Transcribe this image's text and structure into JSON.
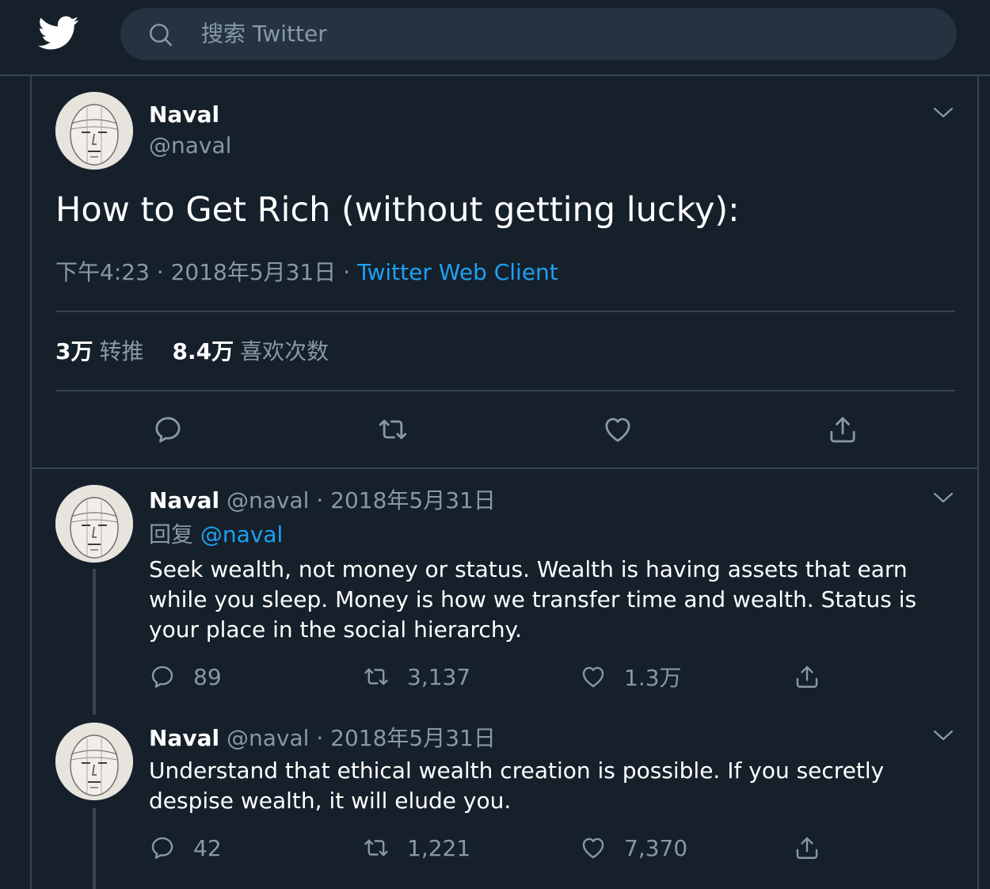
{
  "search": {
    "placeholder": "搜索 Twitter"
  },
  "main_tweet": {
    "name": "Naval",
    "handle": "@naval",
    "text": "How to Get Rich (without getting lucky):",
    "time": "下午4:23",
    "dot": "·",
    "date": "2018年5月31日",
    "source": "Twitter Web Client",
    "retweets_count": "3万",
    "retweets_label": "转推",
    "likes_count": "8.4万",
    "likes_label": "喜欢次数"
  },
  "replies": [
    {
      "name": "Naval",
      "handle": "@naval",
      "dot": "·",
      "date": "2018年5月31日",
      "reply_prefix": "回复",
      "reply_to": "@naval",
      "text": "Seek wealth, not money or status. Wealth is having assets that earn while you sleep. Money is how we transfer time and wealth. Status is your place in the social hierarchy.",
      "replies": "89",
      "retweets": "3,137",
      "likes": "1.3万"
    },
    {
      "name": "Naval",
      "handle": "@naval",
      "dot": "·",
      "date": "2018年5月31日",
      "text": "Understand that ethical wealth creation is possible. If you secretly despise wealth, it will elude you.",
      "replies": "42",
      "retweets": "1,221",
      "likes": "7,370"
    }
  ],
  "icons": {
    "logo": "twitter-bird-icon",
    "search": "search-icon",
    "more": "chevron-down-icon",
    "reply": "reply-icon",
    "retweet": "retweet-icon",
    "like": "heart-icon",
    "share": "share-icon"
  },
  "colors": {
    "background": "#15202b",
    "search_bg": "#253341",
    "border": "#38444d",
    "muted_text": "#8899a6",
    "accent": "#1da1f2"
  }
}
